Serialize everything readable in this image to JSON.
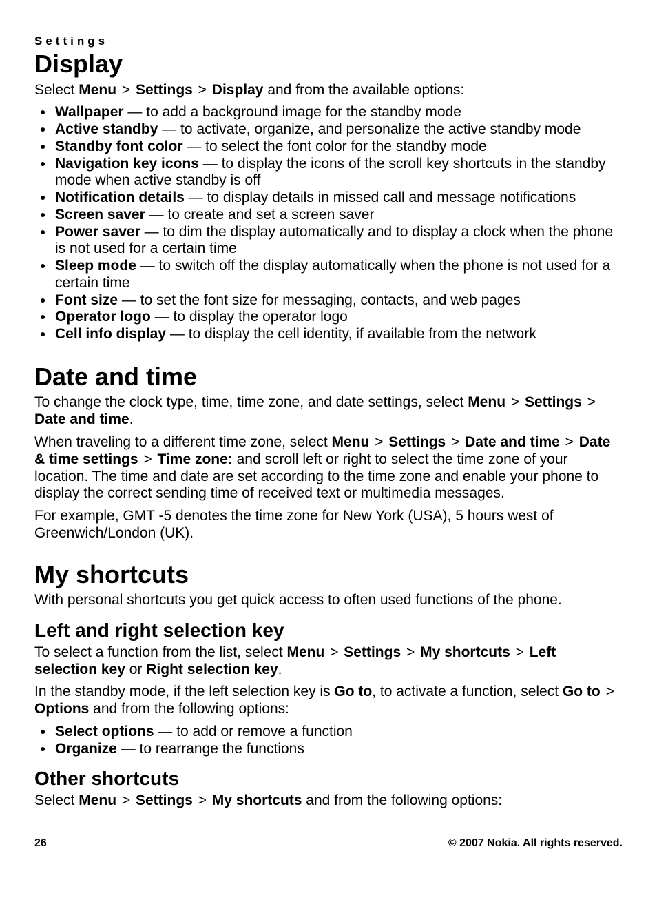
{
  "header": "Settings",
  "sep": ">",
  "display": {
    "title": "Display",
    "intro_prefix": "Select ",
    "intro_path": [
      "Menu",
      "Settings",
      "Display"
    ],
    "intro_suffix": " and from the available options:",
    "items": [
      {
        "name": "Wallpaper",
        "desc": " — to add a background image for the standby mode"
      },
      {
        "name": "Active standby",
        "desc": " — to activate, organize, and personalize the active standby mode"
      },
      {
        "name": "Standby font color",
        "desc": " — to select the font color for the standby mode"
      },
      {
        "name": "Navigation key icons",
        "desc": " — to display the icons of the scroll key shortcuts in the standby mode when active standby is off"
      },
      {
        "name": "Notification details",
        "desc": " — to display details in missed call and message notifications"
      },
      {
        "name": "Screen saver",
        "desc": " — to create and set a screen saver"
      },
      {
        "name": "Power saver",
        "desc": " — to dim the display automatically and to display a clock when the phone is not used for a certain time"
      },
      {
        "name": "Sleep mode",
        "desc": " — to switch off the display automatically when the phone is not used for a certain time"
      },
      {
        "name": "Font size",
        "desc": " — to set the font size for messaging, contacts, and web pages"
      },
      {
        "name": "Operator logo",
        "desc": " — to display the operator logo"
      },
      {
        "name": "Cell info display",
        "desc": " — to display the cell identity, if available from the network"
      }
    ]
  },
  "datetime": {
    "title": "Date and time",
    "p1_prefix": "To change the clock type, time, time zone, and date settings, select ",
    "p1_path": [
      "Menu",
      "Settings",
      "Date and time"
    ],
    "p1_suffix": ".",
    "p2_prefix": "When traveling to a different time zone, select ",
    "p2_path": [
      "Menu",
      "Settings",
      "Date and time",
      "Date & time settings",
      "Time zone:"
    ],
    "p2_suffix": " and scroll left or right to select the time zone of your location. The time and date are set according to the time zone and enable your phone to display the correct sending time of received text or multimedia messages.",
    "p3": "For example, GMT -5 denotes the time zone for New York (USA), 5 hours west of Greenwich/London (UK)."
  },
  "shortcuts": {
    "title": "My shortcuts",
    "intro": "With personal shortcuts you get quick access to often used functions of the phone.",
    "lr": {
      "title": "Left and right selection key",
      "p1_prefix": "To select a function from the list, select ",
      "p1_path": [
        "Menu",
        "Settings",
        "My shortcuts",
        "Left selection key"
      ],
      "p1_or": " or ",
      "p1_alt": "Right selection key",
      "p1_suffix": ".",
      "p2_prefix": "In the standby mode, if the left selection key is ",
      "p2_goto": "Go to",
      "p2_mid": ", to activate a function, select ",
      "p2_path": [
        "Go to",
        "Options"
      ],
      "p2_suffix": " and from the following options:",
      "items": [
        {
          "name": "Select options",
          "desc": " — to add or remove a function"
        },
        {
          "name": "Organize",
          "desc": " — to rearrange the functions"
        }
      ]
    },
    "other": {
      "title": "Other shortcuts",
      "p1_prefix": "Select ",
      "p1_path": [
        "Menu",
        "Settings",
        "My shortcuts"
      ],
      "p1_suffix": " and from the following options:"
    }
  },
  "footer": {
    "page": "26",
    "copyright": "© 2007 Nokia. All rights reserved."
  }
}
